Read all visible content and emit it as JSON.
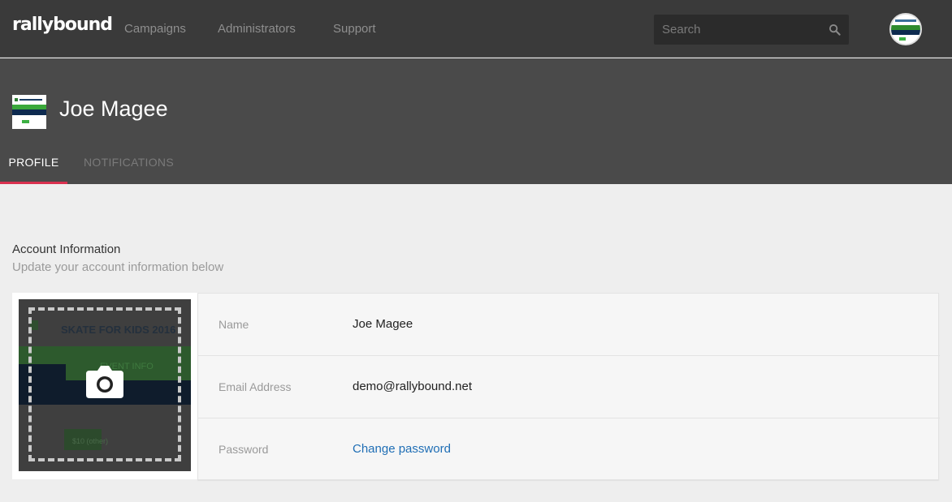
{
  "nav": {
    "logo": "rallybound",
    "links": [
      "Campaigns",
      "Administrators",
      "Support"
    ],
    "search_placeholder": "Search"
  },
  "profile_header": {
    "name": "Joe Magee",
    "tabs": [
      "PROFILE",
      "NOTIFICATIONS"
    ],
    "active_tab": "PROFILE"
  },
  "account": {
    "title": "Account Information",
    "subtitle": "Update your account information below",
    "photo_text": {
      "banner": "SKATE FOR KIDS 2016",
      "event": "EVENT INFO",
      "button": "$10 (other)"
    },
    "fields": [
      {
        "label": "Name",
        "value": "Joe Magee"
      },
      {
        "label": "Email Address",
        "value": "demo@rallybound.net"
      },
      {
        "label": "Password",
        "value": "Change password"
      }
    ]
  },
  "colors": {
    "topbar": "#3a3a3a",
    "header": "#4a4a4a",
    "active_tab_underline": "#d9304f",
    "link": "#1f6eb5"
  }
}
